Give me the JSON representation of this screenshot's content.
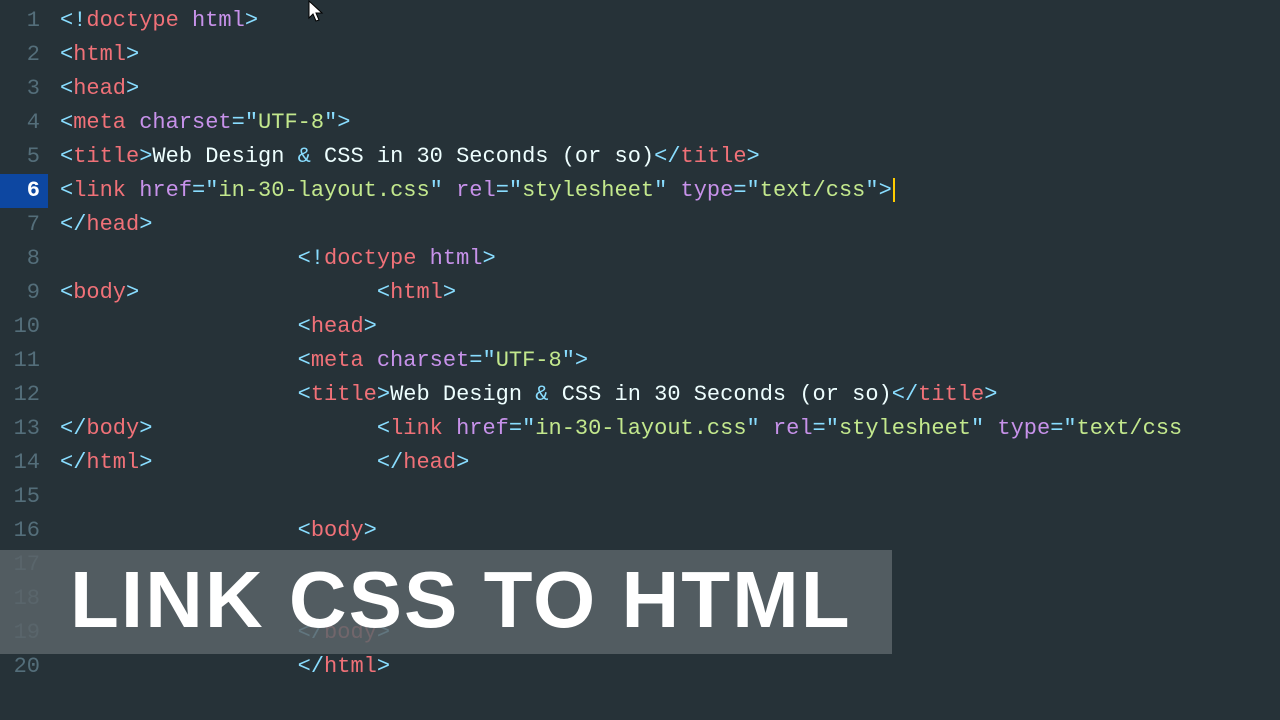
{
  "active_line": 6,
  "lines": [
    {
      "n": 1,
      "tokens": [
        [
          "brkt",
          "<!"
        ],
        [
          "tag",
          "doctype"
        ],
        [
          "txt",
          " "
        ],
        [
          "attr",
          "html"
        ],
        [
          "brkt",
          ">"
        ]
      ]
    },
    {
      "n": 2,
      "tokens": [
        [
          "brkt",
          "<"
        ],
        [
          "tag",
          "html"
        ],
        [
          "brkt",
          ">"
        ]
      ]
    },
    {
      "n": 3,
      "tokens": [
        [
          "brkt",
          "<"
        ],
        [
          "tag",
          "head"
        ],
        [
          "brkt",
          ">"
        ]
      ]
    },
    {
      "n": 4,
      "tokens": [
        [
          "brkt",
          "<"
        ],
        [
          "tag",
          "meta"
        ],
        [
          "txt",
          " "
        ],
        [
          "attr",
          "charset"
        ],
        [
          "op",
          "="
        ],
        [
          "brkt",
          "\""
        ],
        [
          "str",
          "UTF-8"
        ],
        [
          "brkt",
          "\""
        ],
        [
          "brkt",
          ">"
        ]
      ]
    },
    {
      "n": 5,
      "tokens": [
        [
          "brkt",
          "<"
        ],
        [
          "tag",
          "title"
        ],
        [
          "brkt",
          ">"
        ],
        [
          "txt",
          "Web Design "
        ],
        [
          "op",
          "&"
        ],
        [
          "txt",
          " CSS in 30 Seconds (or so)"
        ],
        [
          "brkt",
          "</"
        ],
        [
          "tag",
          "title"
        ],
        [
          "brkt",
          ">"
        ]
      ]
    },
    {
      "n": 6,
      "tokens": [
        [
          "brkt",
          "<"
        ],
        [
          "tag",
          "link"
        ],
        [
          "txt",
          " "
        ],
        [
          "attr",
          "href"
        ],
        [
          "op",
          "="
        ],
        [
          "brkt",
          "\""
        ],
        [
          "str",
          "in-30-layout.css"
        ],
        [
          "brkt",
          "\""
        ],
        [
          "txt",
          " "
        ],
        [
          "attr",
          "rel"
        ],
        [
          "op",
          "="
        ],
        [
          "brkt",
          "\""
        ],
        [
          "str",
          "stylesheet"
        ],
        [
          "brkt",
          "\""
        ],
        [
          "txt",
          " "
        ],
        [
          "attr",
          "type"
        ],
        [
          "op",
          "="
        ],
        [
          "brkt",
          "\""
        ],
        [
          "str",
          "text/css"
        ],
        [
          "brkt",
          "\""
        ],
        [
          "brkt",
          ">"
        ]
      ],
      "cursor": true
    },
    {
      "n": 7,
      "tokens": [
        [
          "brkt",
          "</"
        ],
        [
          "tag",
          "head"
        ],
        [
          "brkt",
          ">"
        ]
      ]
    },
    {
      "n": 8,
      "indent": "                  ",
      "tokens": [
        [
          "brkt",
          "<!"
        ],
        [
          "tag",
          "doctype"
        ],
        [
          "txt",
          " "
        ],
        [
          "attr",
          "html"
        ],
        [
          "brkt",
          ">"
        ]
      ]
    },
    {
      "n": 9,
      "tokens": [
        [
          "brkt",
          "<"
        ],
        [
          "tag",
          "body"
        ],
        [
          "brkt",
          ">"
        ],
        [
          "pad",
          "                  "
        ],
        [
          "brkt",
          "<"
        ],
        [
          "tag",
          "html"
        ],
        [
          "brkt",
          ">"
        ]
      ]
    },
    {
      "n": 10,
      "indent": "                  ",
      "tokens": [
        [
          "brkt",
          "<"
        ],
        [
          "tag",
          "head"
        ],
        [
          "brkt",
          ">"
        ]
      ]
    },
    {
      "n": 11,
      "indent": "                  ",
      "tokens": [
        [
          "brkt",
          "<"
        ],
        [
          "tag",
          "meta"
        ],
        [
          "txt",
          " "
        ],
        [
          "attr",
          "charset"
        ],
        [
          "op",
          "="
        ],
        [
          "brkt",
          "\""
        ],
        [
          "str",
          "UTF-8"
        ],
        [
          "brkt",
          "\""
        ],
        [
          "brkt",
          ">"
        ]
      ]
    },
    {
      "n": 12,
      "indent": "                  ",
      "tokens": [
        [
          "brkt",
          "<"
        ],
        [
          "tag",
          "title"
        ],
        [
          "brkt",
          ">"
        ],
        [
          "txt",
          "Web Design "
        ],
        [
          "op",
          "&"
        ],
        [
          "txt",
          " CSS in 30 Seconds (or so)"
        ],
        [
          "brkt",
          "</"
        ],
        [
          "tag",
          "title"
        ],
        [
          "brkt",
          ">"
        ]
      ]
    },
    {
      "n": 13,
      "tokens": [
        [
          "brkt",
          "</"
        ],
        [
          "tag",
          "body"
        ],
        [
          "brkt",
          ">"
        ],
        [
          "pad",
          "                 "
        ],
        [
          "brkt",
          "<"
        ],
        [
          "tag",
          "link"
        ],
        [
          "txt",
          " "
        ],
        [
          "attr",
          "href"
        ],
        [
          "op",
          "="
        ],
        [
          "brkt",
          "\""
        ],
        [
          "str",
          "in-30-layout.css"
        ],
        [
          "brkt",
          "\""
        ],
        [
          "txt",
          " "
        ],
        [
          "attr",
          "rel"
        ],
        [
          "op",
          "="
        ],
        [
          "brkt",
          "\""
        ],
        [
          "str",
          "stylesheet"
        ],
        [
          "brkt",
          "\""
        ],
        [
          "txt",
          " "
        ],
        [
          "attr",
          "type"
        ],
        [
          "op",
          "="
        ],
        [
          "brkt",
          "\""
        ],
        [
          "str",
          "text/css"
        ]
      ]
    },
    {
      "n": 14,
      "tokens": [
        [
          "brkt",
          "</"
        ],
        [
          "tag",
          "html"
        ],
        [
          "brkt",
          ">"
        ],
        [
          "pad",
          "                 "
        ],
        [
          "brkt",
          "</"
        ],
        [
          "tag",
          "head"
        ],
        [
          "brkt",
          ">"
        ]
      ]
    },
    {
      "n": 15,
      "tokens": []
    },
    {
      "n": 16,
      "indent": "                  ",
      "tokens": [
        [
          "brkt",
          "<"
        ],
        [
          "tag",
          "body"
        ],
        [
          "brkt",
          ">"
        ]
      ]
    },
    {
      "n": 17,
      "tokens": []
    },
    {
      "n": 18,
      "tokens": []
    },
    {
      "n": 19,
      "indent": "                  ",
      "tokens": [
        [
          "brkt",
          "</"
        ],
        [
          "tag",
          "body"
        ],
        [
          "brkt",
          ">"
        ]
      ]
    },
    {
      "n": 20,
      "indent": "                  ",
      "tokens": [
        [
          "brkt",
          "</"
        ],
        [
          "tag",
          "html"
        ],
        [
          "brkt",
          ">"
        ]
      ]
    }
  ],
  "banner": "LINK CSS TO HTML"
}
